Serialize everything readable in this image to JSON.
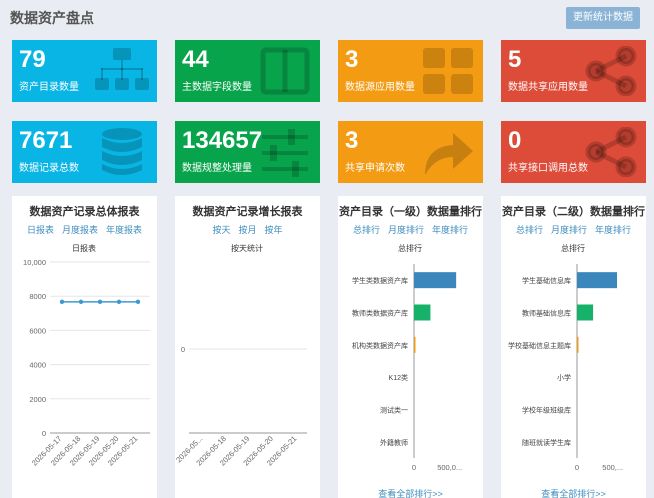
{
  "header": {
    "title": "数据资产盘点",
    "refresh_label": "更新统计数据"
  },
  "tiles": [
    {
      "value": "79",
      "label": "资产目录数量",
      "icon": "sitemap-icon",
      "color": "#08b5e5"
    },
    {
      "value": "44",
      "label": "主数据字段数量",
      "icon": "columns-icon",
      "color": "#08a44c"
    },
    {
      "value": "3",
      "label": "数据源应用数量",
      "icon": "grid-icon",
      "color": "#f39b13"
    },
    {
      "value": "5",
      "label": "数据共享应用数量",
      "icon": "share-icon",
      "color": "#dd4b39"
    },
    {
      "value": "7671",
      "label": "数据记录总数",
      "icon": "database-icon",
      "color": "#08b5e5"
    },
    {
      "value": "134657",
      "label": "数据规整处理量",
      "icon": "sliders-icon",
      "color": "#08a44c"
    },
    {
      "value": "3",
      "label": "共享申请次数",
      "icon": "share-arrow-icon",
      "color": "#f39b13"
    },
    {
      "value": "0",
      "label": "共享接口调用总数",
      "icon": "share-icon",
      "color": "#dd4b39"
    }
  ],
  "panels": [
    {
      "title": "数据资产记录总体报表",
      "tabs": [
        "日报表",
        "月度报表",
        "年度报表"
      ]
    },
    {
      "title": "数据资产记录增长报表",
      "tabs": [
        "按天",
        "按月",
        "按年"
      ]
    },
    {
      "title": "资产目录（一级）数据量排行",
      "tabs": [
        "总排行",
        "月度排行",
        "年度排行"
      ],
      "more": "查看全部排行>>"
    },
    {
      "title": "资产目录（二级）数据量排行",
      "tabs": [
        "总排行",
        "月度排行",
        "年度排行"
      ],
      "more": "查看全部排行>>"
    }
  ],
  "chart_data": [
    {
      "type": "line",
      "title": "日报表",
      "x": [
        "2026-05-17",
        "2026-05-18",
        "2026-05-19",
        "2026-05-20",
        "2026-05-21"
      ],
      "series": [
        {
          "values": [
            7671,
            7671,
            7671,
            7671,
            7671
          ]
        }
      ],
      "ylim": [
        0,
        10000
      ],
      "yticks": [
        "0",
        "2000",
        "4000",
        "6000",
        "8000",
        "10,000"
      ],
      "grid": true,
      "color": "#3d9ad1"
    },
    {
      "type": "line",
      "title": "按天统计",
      "x": [
        "2026-05...",
        "2026-05-18",
        "2026-05-19",
        "2026-05-20",
        "2026-05-21"
      ],
      "series": [],
      "yticks": [
        "0"
      ]
    },
    {
      "type": "bar",
      "orientation": "horizontal",
      "title": "总排行",
      "categories": [
        "学生类数据资产库",
        "教师类数据资产库",
        "机构类数据资产库",
        "K12类",
        "测试类一",
        "外籍教师"
      ],
      "values": [
        590000,
        230000,
        8000,
        0,
        0,
        0
      ],
      "bar_colors": [
        "#3b86bd",
        "#17b26a",
        "#f39b13",
        "#cccccc",
        "#cccccc",
        "#cccccc"
      ],
      "xticks": [
        "0",
        "500,0..."
      ],
      "xlim": [
        0,
        700000
      ]
    },
    {
      "type": "bar",
      "orientation": "horizontal",
      "title": "总排行",
      "categories": [
        "学生基础信息库",
        "教师基础信息库",
        "学校基础信息主题库",
        "小学",
        "学校年级班级库",
        "随班就读学生库"
      ],
      "values": [
        560000,
        225000,
        7000,
        0,
        0,
        0
      ],
      "bar_colors": [
        "#3b86bd",
        "#17b26a",
        "#f39b13",
        "#cccccc",
        "#cccccc",
        "#cccccc"
      ],
      "xticks": [
        "0",
        "500,..."
      ],
      "xlim": [
        0,
        700000
      ]
    }
  ]
}
